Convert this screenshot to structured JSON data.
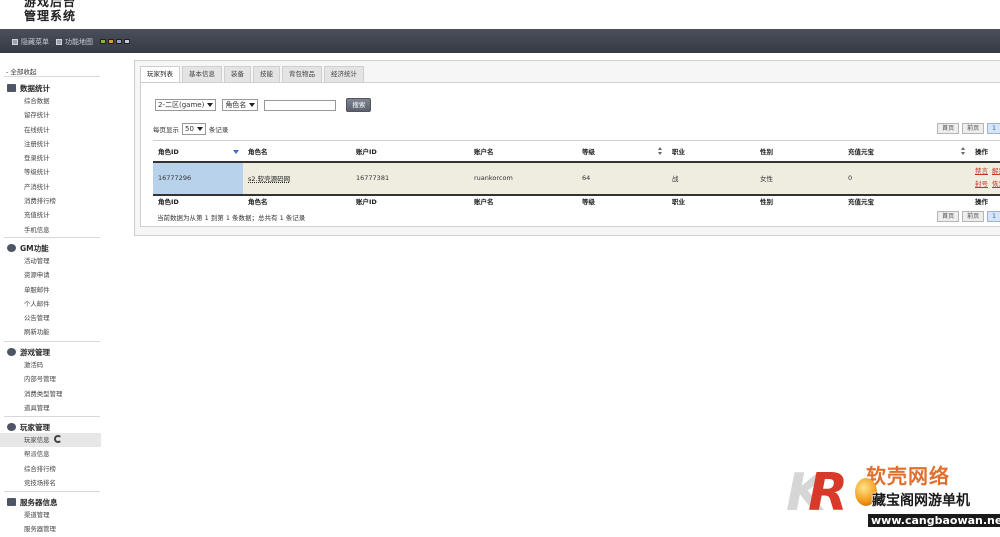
{
  "header": {
    "logo_line1": "游戏后台",
    "logo_line2": "管理系统",
    "toolbar": {
      "hide_menu": "隐藏菜单",
      "sitemap": "功能地图"
    },
    "theme_colors": [
      "#8fb53b",
      "#d9a028",
      "#9aa3b5",
      "#c8cbd2"
    ]
  },
  "sidebar": {
    "collapse_all": "- 全部收起",
    "groups": [
      {
        "title": "数据统计",
        "icon": "bar-chart-icon",
        "items": [
          "综合数据",
          "留存统计",
          "在线统计",
          "注册统计",
          "登录统计",
          "等级统计",
          "产消统计",
          "消费排行榜",
          "充值统计",
          "手机信息"
        ]
      },
      {
        "title": "GM功能",
        "icon": "chat-bubble-icon",
        "items": [
          "活动管理",
          "资源申请",
          "单服邮件",
          "个人邮件",
          "公告管理",
          "刷新功能"
        ]
      },
      {
        "title": "游戏管理",
        "icon": "chat-bubble-icon",
        "items": [
          "激活码",
          "内部号管理",
          "消费类型管理",
          "道具管理"
        ]
      },
      {
        "title": "玩家管理",
        "icon": "user-icon",
        "items": [
          "玩家信息",
          "帮派信息",
          "综合排行榜",
          "竞技场排名"
        ],
        "active": "玩家信息"
      },
      {
        "title": "服务器信息",
        "icon": "server-icon",
        "items": [
          "渠道管理",
          "服务器管理"
        ]
      }
    ]
  },
  "tabs": [
    "玩家列表",
    "基本信息",
    "装备",
    "技能",
    "背包物品",
    "经济统计"
  ],
  "filters": {
    "server": "2-二区(game)",
    "field": "角色名",
    "keyword": "",
    "search_label": "搜索"
  },
  "per_page": {
    "prefix": "每页显示",
    "value": "50",
    "suffix": "条记录"
  },
  "pager": {
    "first": "首页",
    "prev": "前页",
    "current": "1"
  },
  "table": {
    "columns": [
      "角色ID",
      "角色名",
      "账户ID",
      "账户名",
      "等级",
      "职业",
      "性别",
      "充值元宝",
      "操作"
    ],
    "rows": [
      {
        "role_id": "16777296",
        "role_name": "s2.软壳源码网",
        "account_id": "16777381",
        "account_name": "ruankorcom",
        "level": "64",
        "job": "战",
        "gender": "女性",
        "gold": "0",
        "ops": [
          "禁言",
          "解禁",
          "封号",
          "恢复"
        ]
      }
    ]
  },
  "summary": "当前数据为从第 1 到第 1 条数据；总共有 1 条记录",
  "watermark": {
    "logo_letters": "R",
    "brand": "软壳网络",
    "tagline": "藏宝阁网游单机",
    "url": "www.cangbaowan.net"
  }
}
